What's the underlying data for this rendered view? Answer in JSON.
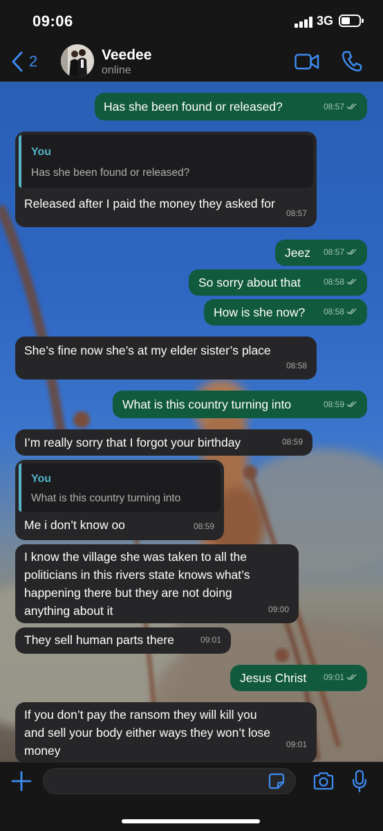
{
  "status_bar": {
    "time": "09:06",
    "network": "3G"
  },
  "header": {
    "back_count": "2",
    "contact_name": "Veedee",
    "contact_status": "online"
  },
  "messages": [
    {
      "dir": "out",
      "text": "Has she been found or released?",
      "time": "08:57"
    },
    {
      "dir": "in",
      "quote_name": "You",
      "quote_text": "Has she been found or released?",
      "text": "Released after I paid the money they asked for",
      "time": "08:57"
    },
    {
      "dir": "out",
      "text": "Jeez",
      "time": "08:57"
    },
    {
      "dir": "out",
      "text": "So sorry about that",
      "time": "08:58"
    },
    {
      "dir": "out",
      "text": "How is she now?",
      "time": "08:58"
    },
    {
      "dir": "in",
      "text": "She’s fine now she’s at my elder sister’s place",
      "time": "08:58"
    },
    {
      "dir": "out",
      "text": "What is this country turning into",
      "time": "08:59"
    },
    {
      "dir": "in",
      "text": "I’m really sorry that I forgot your birthday",
      "time": "08:59"
    },
    {
      "dir": "in",
      "quote_name": "You",
      "quote_text": "What is this country turning into",
      "text": "Me i don’t know oo",
      "time": "08:59"
    },
    {
      "dir": "in",
      "lines": [
        "I know the village she was taken to all the",
        "politicians in this rivers state knows what’s",
        "happening there but they are not doing",
        "anything about it"
      ],
      "time": "09:00"
    },
    {
      "dir": "in",
      "text": "They sell human parts there",
      "time": "09:01"
    },
    {
      "dir": "out",
      "text": "Jesus Christ",
      "time": "09:01"
    },
    {
      "dir": "in",
      "lines": [
        "If you don’t pay the ransom they will kill you",
        "and sell your body either ways they won’t lose",
        "money"
      ],
      "time": "09:01"
    }
  ],
  "input": {
    "value": "",
    "placeholder": ""
  },
  "icons": [
    "chevron-left-icon",
    "video-call-icon",
    "phone-icon",
    "plus-icon",
    "sticker-icon",
    "camera-icon",
    "microphone-icon",
    "read-ticks-icon"
  ],
  "colors": {
    "accent": "#3d8bf0",
    "outgoing_bubble": "#125a3e",
    "incoming_bubble": "#262628",
    "quote_accent": "#52b3c9"
  }
}
